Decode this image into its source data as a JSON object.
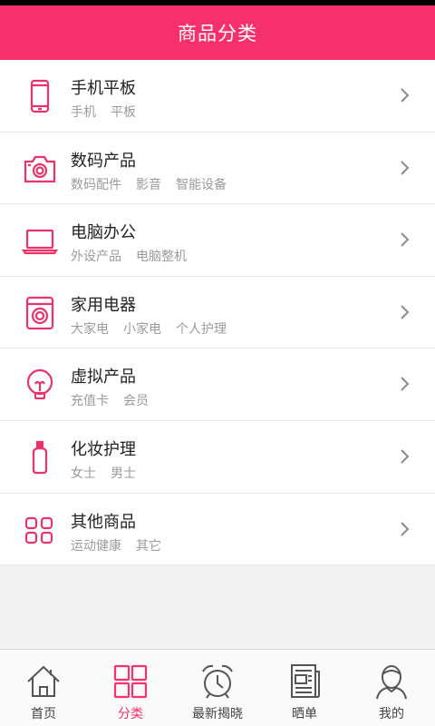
{
  "header": {
    "title": "商品分类"
  },
  "colors": {
    "accent": "#f8306b",
    "icon": "#e8336b"
  },
  "categories": [
    {
      "icon": "phone-icon",
      "title": "手机平板",
      "subs": [
        "手机",
        "平板"
      ]
    },
    {
      "icon": "camera-icon",
      "title": "数码产品",
      "subs": [
        "数码配件",
        "影音",
        "智能设备"
      ]
    },
    {
      "icon": "laptop-icon",
      "title": "电脑办公",
      "subs": [
        "外设产品",
        "电脑整机"
      ]
    },
    {
      "icon": "washer-icon",
      "title": "家用电器",
      "subs": [
        "大家电",
        "小家电",
        "个人护理"
      ]
    },
    {
      "icon": "lightbulb-icon",
      "title": "虚拟产品",
      "subs": [
        "充值卡",
        "会员"
      ]
    },
    {
      "icon": "bottle-icon",
      "title": "化妆护理",
      "subs": [
        "女士",
        "男士"
      ]
    },
    {
      "icon": "grid-icon",
      "title": "其他商品",
      "subs": [
        "运动健康",
        "其它"
      ]
    }
  ],
  "tabs": [
    {
      "icon": "home-icon",
      "label": "首页",
      "active": false
    },
    {
      "icon": "category-icon",
      "label": "分类",
      "active": true
    },
    {
      "icon": "alarm-clock-icon",
      "label": "最新揭晓",
      "active": false
    },
    {
      "icon": "newspaper-icon",
      "label": "晒单",
      "active": false
    },
    {
      "icon": "user-icon",
      "label": "我的",
      "active": false
    }
  ]
}
